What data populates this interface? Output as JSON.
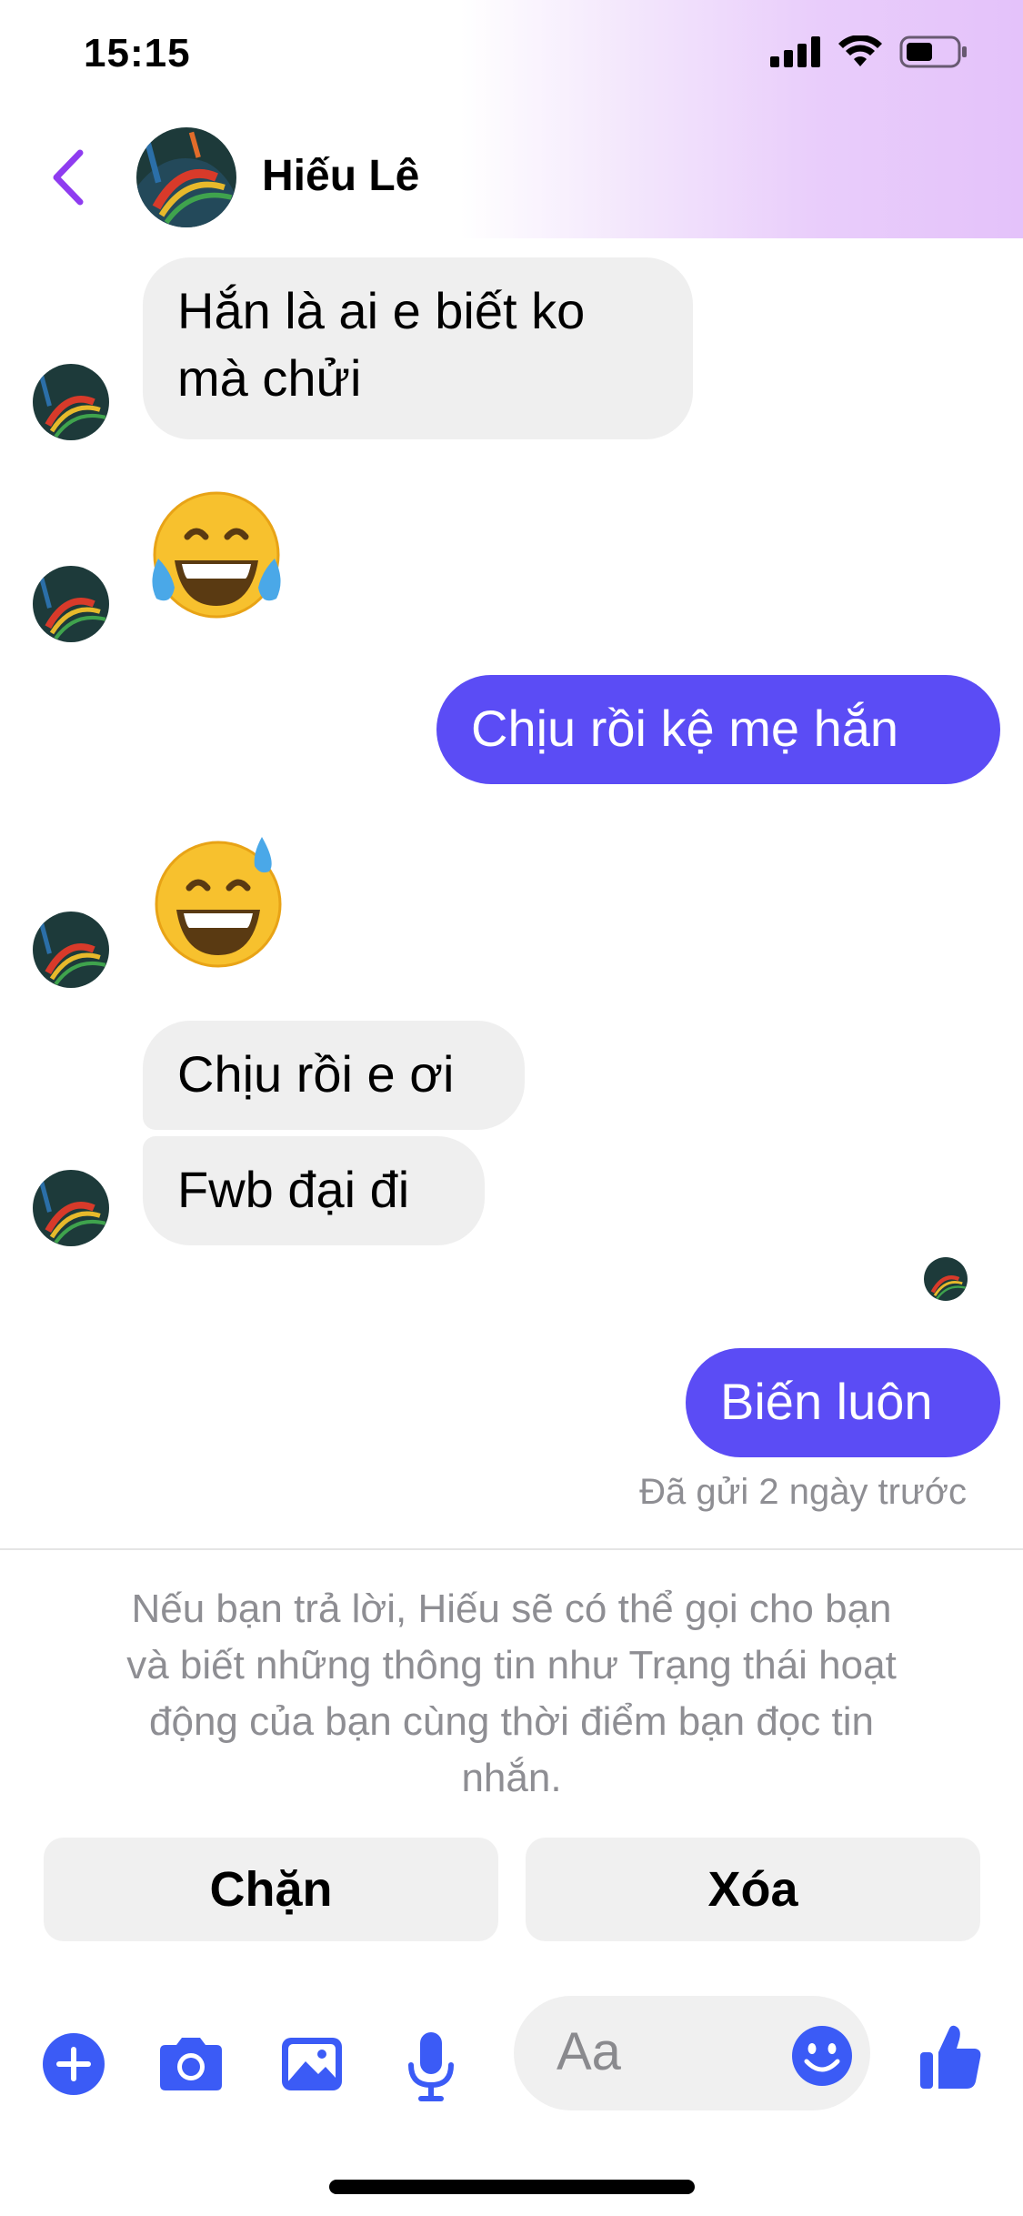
{
  "status_bar": {
    "time": "15:15"
  },
  "header": {
    "contact_name": "Hiếu Lê"
  },
  "messages": [
    {
      "direction": "in",
      "text_lines": [
        "Hắn là ai e biết ko",
        "mà chửi"
      ]
    },
    {
      "direction": "in",
      "emoji": "face-with-tears-of-joy"
    },
    {
      "direction": "out",
      "text": "Chịu rồi kệ mẹ hắn"
    },
    {
      "direction": "in",
      "emoji": "grinning-face-with-sweat"
    },
    {
      "direction": "in",
      "text": "Chịu rồi e ơi"
    },
    {
      "direction": "in",
      "text": "Fwb đại đi"
    },
    {
      "direction": "out",
      "text": "Biến luôn"
    }
  ],
  "sent_status": "Đã gửi 2 ngày trước",
  "notice": {
    "lines": [
      "Nếu bạn trả lời, Hiếu sẽ có thể gọi cho bạn",
      "và biết những thông tin như Trạng thái hoạt",
      "động của bạn cùng thời điểm bạn đọc tin",
      "nhắn."
    ]
  },
  "actions": {
    "block_label": "Chặn",
    "delete_label": "Xóa"
  },
  "composer": {
    "placeholder": "Aa"
  },
  "icons": {
    "back": "chevron-left-icon",
    "plus": "plus-circle-icon",
    "camera": "camera-icon",
    "gallery": "image-icon",
    "mic": "microphone-icon",
    "emoji": "smiley-icon",
    "like": "thumbs-up-icon"
  },
  "colors": {
    "accent_purple": "#8f3cf0",
    "outgoing_bubble": "#5b4cf5",
    "incoming_bubble": "#efefef",
    "composer_blue": "#3b5bf6",
    "muted_text": "#8e8e93"
  }
}
